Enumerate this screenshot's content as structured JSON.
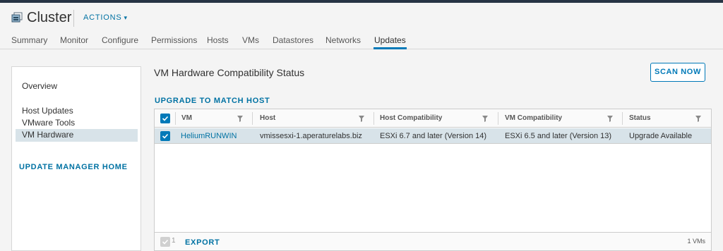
{
  "header": {
    "title": "Cluster",
    "actions_label": "ACTIONS",
    "icon": "cluster-icon"
  },
  "tabs": [
    {
      "label": "Summary",
      "active": false
    },
    {
      "label": "Monitor",
      "active": false
    },
    {
      "label": "Configure",
      "active": false
    },
    {
      "label": "Permissions",
      "active": false
    },
    {
      "label": "Hosts",
      "active": false
    },
    {
      "label": "VMs",
      "active": false
    },
    {
      "label": "Datastores",
      "active": false
    },
    {
      "label": "Networks",
      "active": false
    },
    {
      "label": "Updates",
      "active": true
    }
  ],
  "sidebar": {
    "items": [
      {
        "label": "Overview"
      },
      {
        "label": "Host Updates"
      },
      {
        "label": "VMware Tools"
      },
      {
        "label": "VM Hardware",
        "active": true
      }
    ],
    "home_link": "UPDATE MANAGER HOME"
  },
  "main": {
    "title": "VM Hardware Compatibility Status",
    "scan_button": "SCAN NOW",
    "upgrade_link": "UPGRADE TO MATCH HOST"
  },
  "grid": {
    "columns": [
      "VM",
      "Host",
      "Host Compatibility",
      "VM Compatibility",
      "Status"
    ],
    "rows": [
      {
        "selected": true,
        "vm": "HeliumRUNWIN",
        "host": "vmissesxi-1.aperaturelabs.biz",
        "host_compat": "ESXi 6.7 and later (Version 14)",
        "vm_compat": "ESXi 6.5 and later (Version 13)",
        "status": "Upgrade Available"
      }
    ],
    "footer": {
      "selected_count": "1",
      "export_label": "EXPORT",
      "total": "1 VMs"
    }
  },
  "colors": {
    "accent": "#0079b8",
    "link": "#0072a3",
    "selected_row": "#d8e3e9",
    "top_strip": "#273444"
  }
}
